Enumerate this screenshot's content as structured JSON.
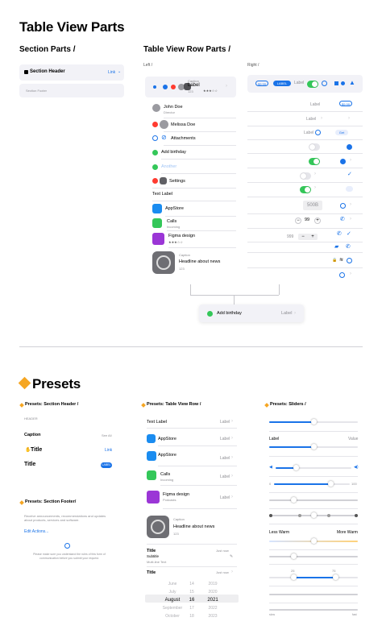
{
  "title_table_view_parts": "Table View Parts",
  "section_parts_heading": "Section Parts /",
  "row_parts_heading": "Table View Row Parts /",
  "left_label": "Left /",
  "right_label": "Right /",
  "section_header": {
    "title": "Section Header",
    "link": "Link"
  },
  "section_footer_text": "Section Footer",
  "left_rows": {
    "caption_row": {
      "caption": "Caption",
      "label": "Label",
      "sub": "123"
    },
    "john": {
      "name": "John Doe",
      "role": "Director"
    },
    "melissa": {
      "name": "Melissa Doe"
    },
    "attachments": "Attachments",
    "add_birthday": "Add birthday",
    "another": "Another",
    "settings": "Settings",
    "text_label": "Text Label",
    "appstore": "AppStore",
    "calls": {
      "title": "Calls",
      "sub": "Incoming"
    },
    "figma": {
      "title": "Figma design"
    },
    "headline": {
      "caption": "Caption",
      "title": "Headline about  news",
      "sub": "123"
    }
  },
  "right_rows": {
    "price_small": "$9.99",
    "label_pill": "LABEL",
    "label_text": "Label",
    "price2": "$9.99",
    "label2": "Label",
    "label3": "Label",
    "get": "Get",
    "storage": "500B",
    "stepper_value": "99",
    "stepper_value2": "999"
  },
  "demo_row": {
    "label": "Add birthday",
    "right": "Label"
  },
  "presets_title": "Presets",
  "presets": {
    "section_header_heading": "Presets: Section Header /",
    "table_row_heading": "Presets: Table View Row /",
    "sliders_heading": "Presets: Sliders /",
    "section_footer_heading": "Presets: Section Footer/",
    "header_rows": {
      "tiny": "HEADER",
      "caption": "Caption",
      "caption_right": "See All",
      "title_icon": "Title",
      "link": "Link",
      "title": "Title",
      "badge": "LABEL"
    },
    "footer": {
      "text": "Receive announcements, recommendations and updates about products, services and software.",
      "action": "Edit Actions...",
      "small": "Please make sure you understand the rules of this form of communication before you submit your request."
    },
    "row_presets": {
      "text_label": "Text Label",
      "label": "Label",
      "appstore": "AppStore",
      "appstore2": "AppStore",
      "calls": "Calls",
      "calls_sub": "Incoming",
      "figma": "Figma design",
      "figma_sub": "Podcasts",
      "caption": "Caption",
      "headline": "Headline about  news",
      "sub": "123",
      "title": "Title",
      "subtitle": "Subtitle",
      "multiline": "Multi-line Text",
      "just_now": "Just now",
      "title2": "Title",
      "just_now2": "Just now"
    },
    "picker": {
      "months": [
        "June",
        "July",
        "August",
        "September",
        "October"
      ],
      "days": [
        "14",
        "15",
        "16",
        "17",
        "18"
      ],
      "years": [
        "2019",
        "2020",
        "2021",
        "2022",
        "2023"
      ]
    },
    "sliders": {
      "label": "Label",
      "value": "Value",
      "min": "0",
      "max": "100",
      "less_warm": "Less Warm",
      "more_warm": "More Warm",
      "low": "25",
      "high": "75",
      "min_text": "slow",
      "max_text": "fast"
    }
  },
  "colors": {
    "accent": "#1a73e8",
    "green": "#34c759",
    "red": "#ff3b30",
    "orange": "#f5a623",
    "purple": "#9b36d6"
  }
}
